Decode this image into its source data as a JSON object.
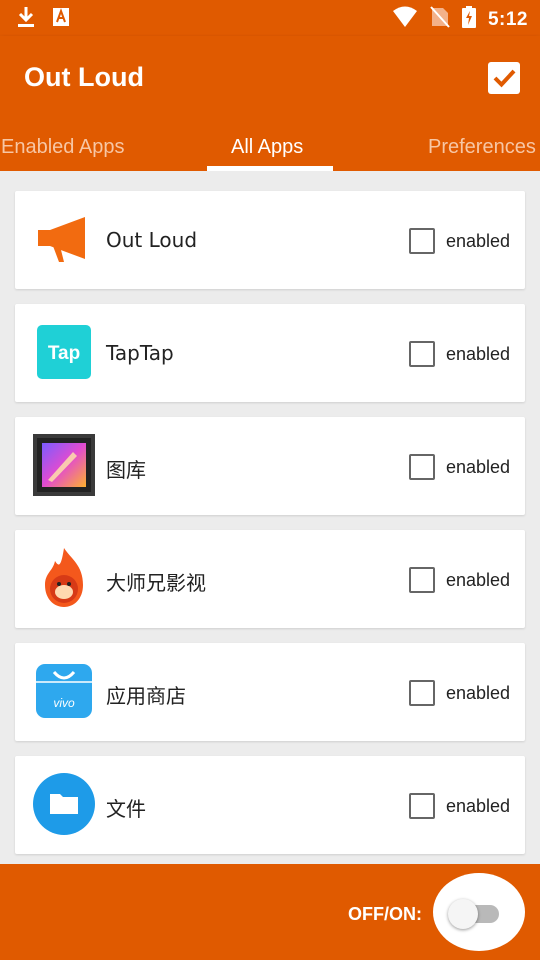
{
  "status_bar": {
    "time": "5:12",
    "icons_left": [
      "download-icon",
      "app-notification-icon"
    ],
    "icons_right": [
      "wifi-icon",
      "no-sim-icon",
      "battery-charging-icon"
    ]
  },
  "app_bar": {
    "title": "Out Loud",
    "action_icon": "checkbox-checked-icon"
  },
  "tabs": [
    {
      "label": "Enabled Apps",
      "active": false
    },
    {
      "label": "All Apps",
      "active": true
    },
    {
      "label": "Preferences",
      "active": false
    }
  ],
  "apps": [
    {
      "name": "Out Loud",
      "icon": "megaphone-icon",
      "checkbox_label": "enabled",
      "checked": false
    },
    {
      "name": "TapTap",
      "icon": "taptap-icon",
      "icon_text": "Tap",
      "checkbox_label": "enabled",
      "checked": false
    },
    {
      "name": "图库",
      "icon": "gallery-icon",
      "checkbox_label": "enabled",
      "checked": false
    },
    {
      "name": "大师兄影视",
      "icon": "flame-monkey-icon",
      "checkbox_label": "enabled",
      "checked": false
    },
    {
      "name": "应用商店",
      "icon": "shopping-bag-icon",
      "icon_text": "vivo",
      "checkbox_label": "enabled",
      "checked": false
    },
    {
      "name": "文件",
      "icon": "folder-icon",
      "checkbox_label": "enabled",
      "checked": false
    }
  ],
  "bottom_bar": {
    "toggle_label": "OFF/ON:",
    "toggle_on": false
  },
  "colors": {
    "primary": "#e05a00",
    "tab_inactive": "#f7c6a4",
    "background": "#ececec"
  }
}
